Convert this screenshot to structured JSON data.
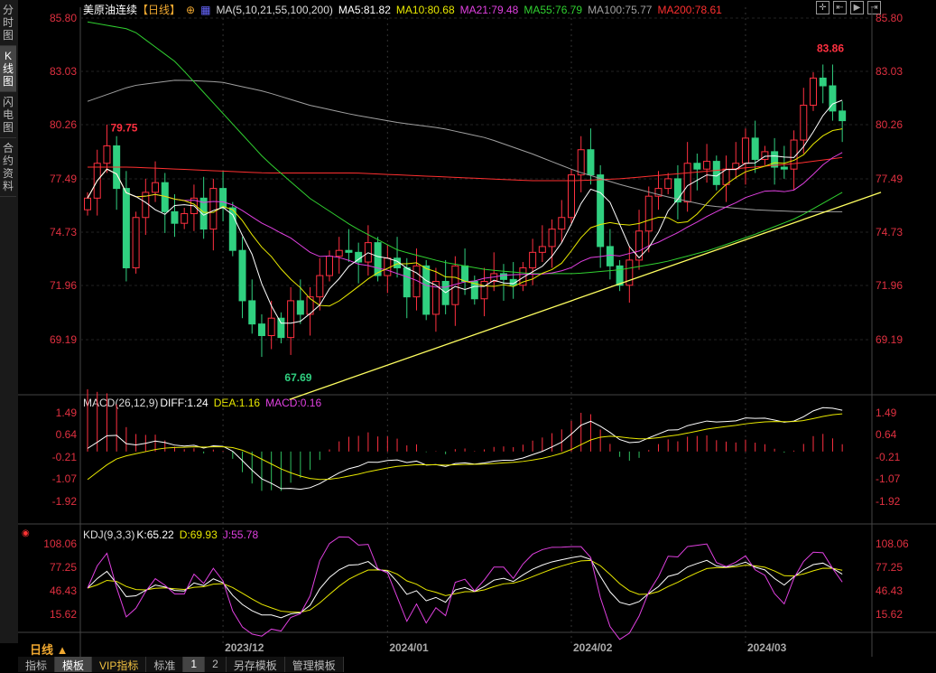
{
  "sidebar": {
    "tabs": [
      "分时图",
      "K线图",
      "闪电图",
      "合约资料"
    ],
    "active": 1
  },
  "header": {
    "title": "美原油连续",
    "period": "【日线】",
    "ma_label": "MA(5,10,21,55,100,200)",
    "ma": [
      {
        "label": "MA5:81.82",
        "color": "#ffffff"
      },
      {
        "label": "MA10:80.68",
        "color": "#e8e800"
      },
      {
        "label": "MA21:79.48",
        "color": "#e040e0"
      },
      {
        "label": "MA55:76.79",
        "color": "#30d030"
      },
      {
        "label": "MA100:75.77",
        "color": "#a0a0a0"
      },
      {
        "label": "MA200:78.61",
        "color": "#ff3030"
      }
    ]
  },
  "tools": [
    "crosshair-icon",
    "zoom-in-icon",
    "zoom-out-icon",
    "move-right-icon"
  ],
  "macd": {
    "name": "MACD(26,12,9)",
    "diff": "DIFF:1.24",
    "dea": "DEA:1.16",
    "macd": "MACD:0.16"
  },
  "kdj": {
    "name": "KDJ(9,3,3)",
    "k": "K:65.22",
    "d": "D:69.93",
    "j": "J:55.78"
  },
  "period_label": "日线 ▲",
  "bottom_tabs": [
    "指标",
    "模板",
    "VIP指标",
    "标准",
    "1",
    "2",
    "另存模板",
    "管理模板"
  ],
  "chart_data": {
    "type": "candlestick",
    "price_ticks": [
      "85.80",
      "83.03",
      "80.26",
      "77.49",
      "74.73",
      "71.96",
      "69.19"
    ],
    "price_range": [
      69.19,
      85.8
    ],
    "macd_ticks": [
      "1.49",
      "0.64",
      "-0.21",
      "-1.07",
      "-1.92"
    ],
    "kdj_ticks": [
      "108.06",
      "77.25",
      "46.43",
      "15.62"
    ],
    "x_labels": [
      "2023/12",
      "2024/01",
      "2024/02",
      "2024/03"
    ],
    "x_label_index": [
      14,
      31,
      50,
      68
    ],
    "annotations": [
      {
        "text": "79.75",
        "index": 2,
        "price": 79.75
      },
      {
        "text": "67.69",
        "index": 20,
        "price": 67.69
      },
      {
        "text": "83.86",
        "index": 75,
        "price": 83.86
      }
    ],
    "closes": [
      76.5,
      78.3,
      79.2,
      77.0,
      72.9,
      75.5,
      76.8,
      77.3,
      75.8,
      75.2,
      75.7,
      76.5,
      74.9,
      77.0,
      76.0,
      73.8,
      71.2,
      70.0,
      69.4,
      70.3,
      69.3,
      71.2,
      70.5,
      71.4,
      72.5,
      73.5,
      73.8,
      73.7,
      73.2,
      74.2,
      72.5,
      73.4,
      72.9,
      71.4,
      73.0,
      70.5,
      72.2,
      71.0,
      73.0,
      72.2,
      71.3,
      72.2,
      72.6,
      72.3,
      72.0,
      72.9,
      73.7,
      74.0,
      74.9,
      75.5,
      77.7,
      79.0,
      77.7,
      74.0,
      73.0,
      72.0,
      73.3,
      74.8,
      76.6,
      77.0,
      77.5,
      76.3,
      78.3,
      78.0,
      78.4,
      77.2,
      78.0,
      78.3,
      79.6,
      78.5,
      78.9,
      78.1,
      78.0,
      79.5,
      81.3,
      82.7,
      82.3,
      81.0,
      80.5
    ],
    "ma55_keypoints": [
      85.6,
      85.2,
      83.5,
      81,
      78.5,
      76.5,
      75,
      73.8,
      73.2,
      72.8,
      72.6,
      72.6,
      72.8,
      73.2,
      73.8,
      74.6,
      75.5,
      76.8
    ],
    "ma100_keypoints": [
      81.5,
      82.3,
      82.6,
      82.5,
      82,
      81.3,
      80.8,
      80.4,
      80.1,
      79.6,
      78.8,
      77.9,
      77.2,
      76.6,
      76.1,
      75.9,
      75.8,
      75.8
    ],
    "ma200_keypoints": [
      78.1,
      78.1,
      78.0,
      77.9,
      77.8,
      77.8,
      77.8,
      77.7,
      77.6,
      77.5,
      77.4,
      77.4,
      77.5,
      77.7,
      77.9,
      78.1,
      78.3,
      78.6
    ],
    "trendline": [
      {
        "index": 12,
        "price": 67.5
      },
      {
        "index": 82,
        "price": 76.8
      }
    ]
  }
}
